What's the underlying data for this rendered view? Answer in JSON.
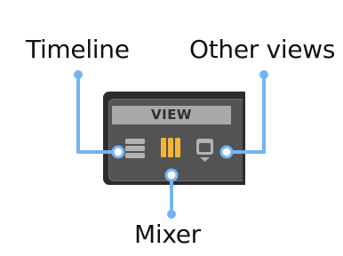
{
  "callouts": {
    "timeline": "Timeline",
    "mixer": "Mixer",
    "other_views": "Other views"
  },
  "panel": {
    "header": "VIEW",
    "buttons": [
      {
        "name": "timeline",
        "icon": "timeline-icon",
        "active": false
      },
      {
        "name": "mixer",
        "icon": "mixer-icon",
        "active": true
      },
      {
        "name": "other-views",
        "icon": "other-views-icon",
        "has_dropdown": true,
        "active": false
      }
    ]
  },
  "colors": {
    "leader_line": "#74b4f2",
    "panel_bg": "#2c2c2c",
    "panel_inner": "#535353",
    "header_bg": "#a9a9a9",
    "icon_inactive": "#b3b3b3",
    "icon_active": "#f4b537"
  }
}
